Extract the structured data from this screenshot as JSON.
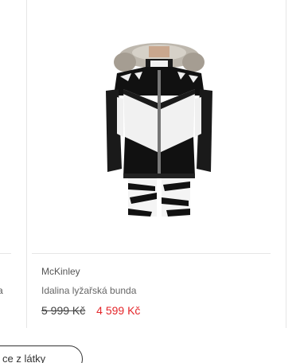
{
  "left_card": {
    "name_fragment": "a"
  },
  "product": {
    "brand": "McKinley",
    "name": "Idalina lyžařská bunda",
    "price_old": "5 999 Kč",
    "price_new": "4 599 Kč",
    "image_alt": "ski-jacket-photo"
  },
  "filter_chip": {
    "label": "ce z látky"
  },
  "colors": {
    "sale_price": "#e4262a",
    "divider": "#e6e6e6"
  }
}
